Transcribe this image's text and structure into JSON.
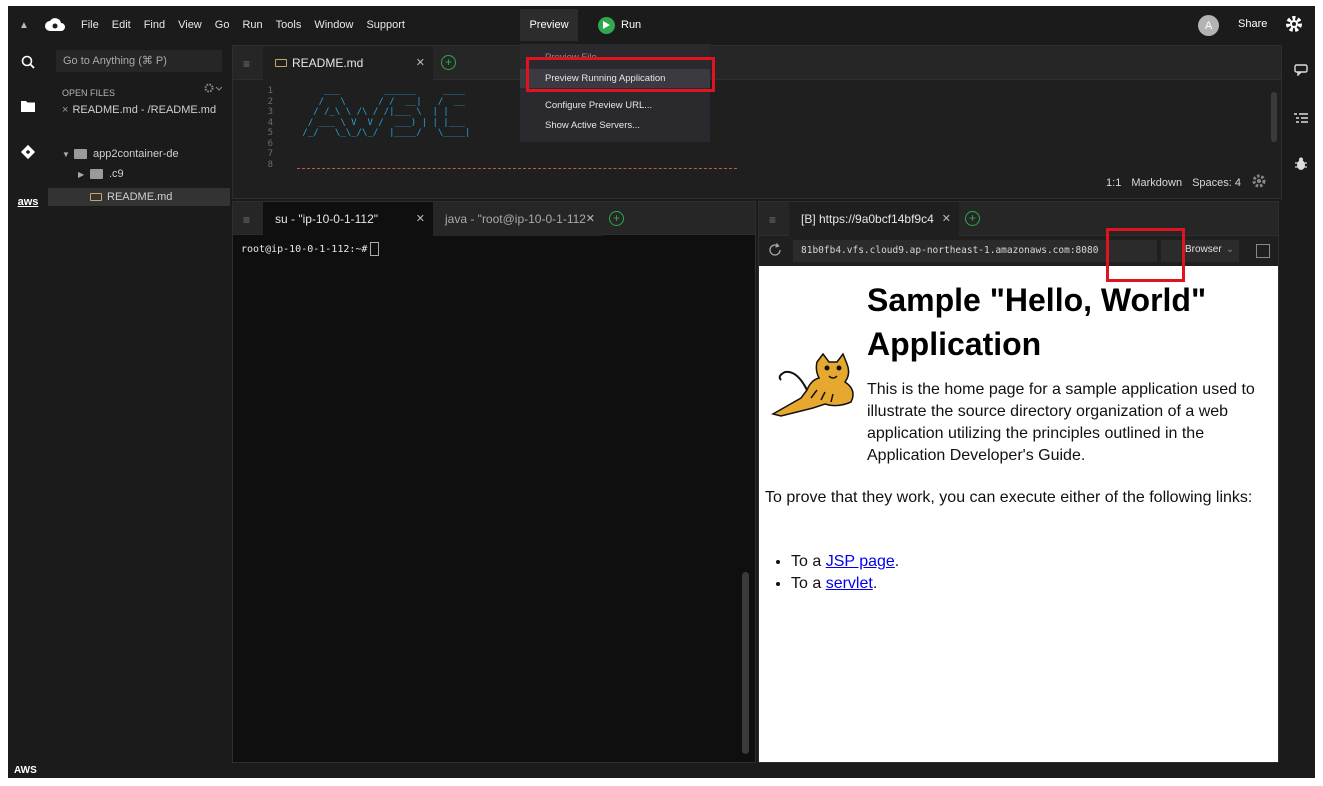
{
  "menubar": {
    "items": [
      "File",
      "Edit",
      "Find",
      "View",
      "Go",
      "Run",
      "Tools",
      "Window",
      "Support"
    ],
    "preview_label": "Preview",
    "run_label": "Run",
    "avatar_letter": "A",
    "share_label": "Share"
  },
  "preview_menu": {
    "items": [
      "Preview File",
      "Preview Running Application",
      "Configure Preview URL...",
      "Show Active Servers..."
    ]
  },
  "sidebar": {
    "goto_placeholder": "Go to Anything (⌘ P)",
    "open_files_title": "OPEN FILES",
    "open_file": "README.md - /README.md",
    "tree": {
      "root": "app2container-de",
      "folder": ".c9",
      "file": "README.md"
    },
    "aws_icon_text": "aws",
    "bottom_label": "AWS"
  },
  "editor": {
    "tab_label": "README.md",
    "line_numbers": [
      "1",
      "2",
      "3",
      "4",
      "5",
      "6",
      "7",
      "8"
    ],
    "code_lines": [
      "     ___        ______     ____",
      "    /   \\      / /  __|   /  __",
      "   / /_\\ \\ /\\ / /|___ \\  | |",
      "  / ___ \\ V  V /  ___) | | |___",
      " /_/   \\_\\_/\\_/  |____/   \\____|"
    ],
    "status": {
      "position": "1:1",
      "mode": "Markdown",
      "spaces": "Spaces: 4"
    }
  },
  "terminal": {
    "tab_active": "su - \"ip-10-0-1-112\"",
    "tab_inactive": "java - \"root@ip-10-0-1-112",
    "prompt": "root@ip-10-0-1-112:~#"
  },
  "browser": {
    "tab_label": "[B] https://9a0bcf14bf9c4",
    "url": "81b0fb4.vfs.cloud9.ap-northeast-1.amazonaws.com:8080",
    "mode_label": "Browser",
    "page": {
      "title": "Sample \"Hello, World\" Application",
      "intro": "This is the home page for a sample application used to illustrate the source directory organization of a web application utilizing the principles outlined in the Application Developer's Guide.",
      "prove": "To prove that they work, you can execute either of the following links:",
      "links": [
        {
          "prefix": "To a ",
          "text": "JSP page",
          "suffix": "."
        },
        {
          "prefix": "To a ",
          "text": "servlet",
          "suffix": "."
        }
      ]
    }
  },
  "colors": {
    "accent_green": "#2fa84f",
    "highlight_red": "#e0141e",
    "ascii_blue": "#27a6d4"
  }
}
